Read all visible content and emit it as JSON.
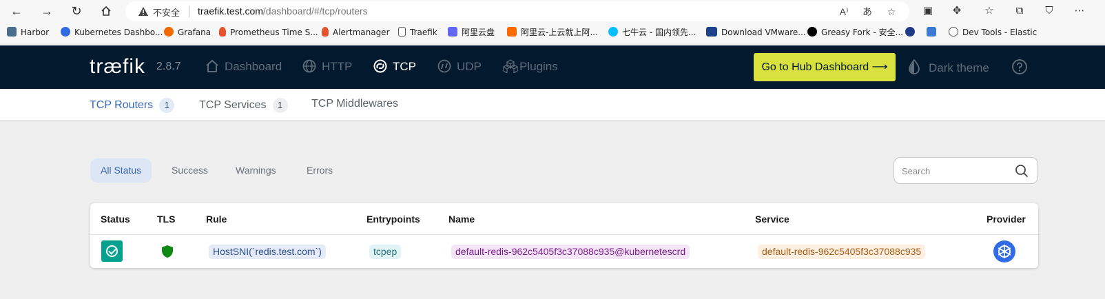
{
  "browser": {
    "insecure_label": "不安全",
    "url_domain": "traefik.test.com",
    "url_path": "/dashboard/#/tcp/routers"
  },
  "bookmarks": [
    {
      "label": "Harbor",
      "color": "#4a6d8c"
    },
    {
      "label": "Kubernetes Dashbo...",
      "color": "#326ce5"
    },
    {
      "label": "Grafana",
      "color": "#f46800"
    },
    {
      "label": "Prometheus Time S...",
      "color": "#e6522c"
    },
    {
      "label": "Alertmanager",
      "color": "#e6522c"
    },
    {
      "label": "Traefik",
      "color": "#555555"
    },
    {
      "label": "阿里云盘",
      "color": "#6366f1"
    },
    {
      "label": "阿里云-上云就上阿...",
      "color": "#ff6a00"
    },
    {
      "label": "七牛云 - 国内领先...",
      "color": "#07beff"
    },
    {
      "label": "Download VMware...",
      "color": "#1d428a"
    },
    {
      "label": "Greasy Fork - 安全...",
      "color": "#000000"
    },
    {
      "label": "",
      "color": "#1f3b8a"
    },
    {
      "label": "",
      "color": "#3b7bd4"
    },
    {
      "label": "Dev Tools - Elastic",
      "color": "#444444"
    }
  ],
  "header": {
    "logo": "træfik",
    "version": "2.8.7",
    "nav": [
      {
        "label": "Dashboard",
        "icon": "home-icon"
      },
      {
        "label": "HTTP",
        "icon": "globe-icon"
      },
      {
        "label": "TCP",
        "icon": "tcp-icon"
      },
      {
        "label": "UDP",
        "icon": "udp-icon"
      },
      {
        "label": "Plugins",
        "icon": "cubes-icon"
      }
    ],
    "hub_button": "Go to Hub Dashboard ⟶",
    "dark_theme": "Dark theme"
  },
  "subtabs": [
    {
      "label": "TCP Routers",
      "count": "1"
    },
    {
      "label": "TCP Services",
      "count": "1"
    },
    {
      "label": "TCP Middlewares",
      "count": ""
    }
  ],
  "filters": [
    "All Status",
    "Success",
    "Warnings",
    "Errors"
  ],
  "search": {
    "placeholder": "Search"
  },
  "table": {
    "headers": [
      "Status",
      "TLS",
      "Rule",
      "Entrypoints",
      "Name",
      "Service",
      "Provider"
    ],
    "rows": [
      {
        "status": "success",
        "tls": "enabled",
        "rule": "HostSNI(`redis.test.com`)",
        "entrypoints": "tcpep",
        "name": "default-redis-962c5405f3c37088c935@kubernetescrd",
        "service": "default-redis-962c5405f3c37088c935",
        "provider": "kubernetes"
      }
    ]
  },
  "colors": {
    "nav_bg": "#03192d",
    "hub_button": "#d9e13f",
    "accent": "#3569b7",
    "success": "#00a28f",
    "tls_shield": "#0e8a14",
    "provider": "#316ce6"
  }
}
